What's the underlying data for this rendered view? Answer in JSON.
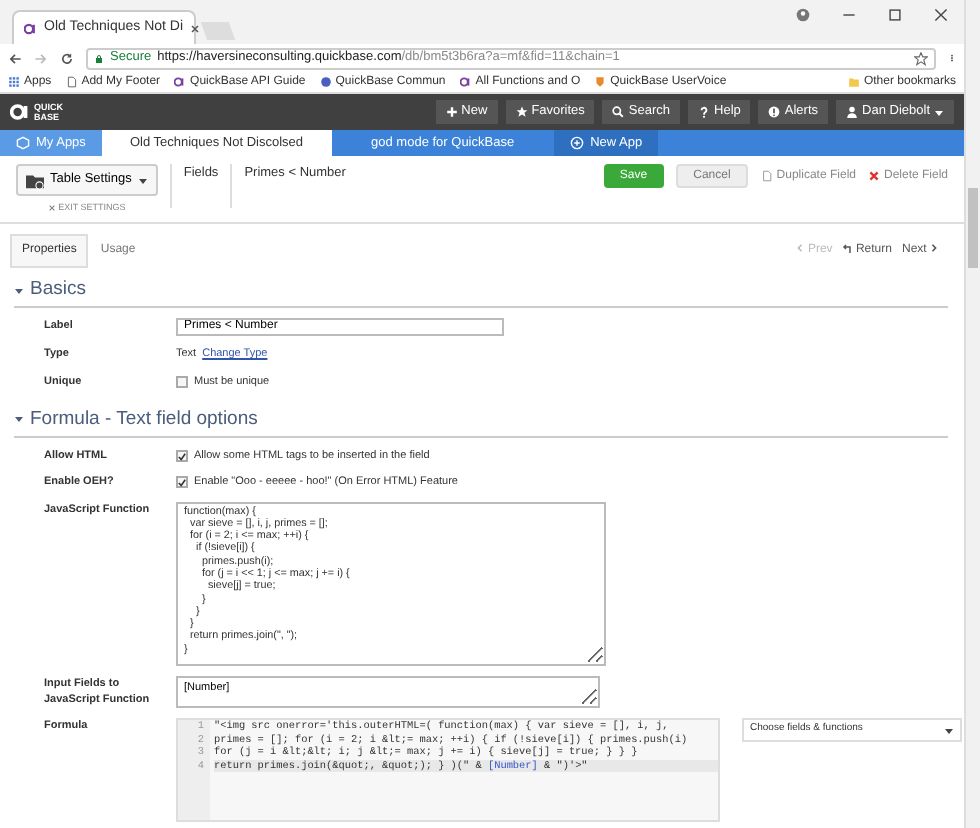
{
  "browser": {
    "tabs": [
      {
        "title": "Old Techniques Not Di",
        "selected": true
      }
    ],
    "secure_label": "Secure",
    "url_host": "https://haversineconsulting.quickbase.com",
    "url_path": "/db/bm5t3b6ra?a=mf&fid=11&chain=1",
    "bookmarks": [
      {
        "label": "Apps",
        "kind": "apps"
      },
      {
        "label": "Add My Footer",
        "kind": "page"
      },
      {
        "label": "QuickBase API Guide",
        "kind": "qb"
      },
      {
        "label": "QuickBase Commun",
        "kind": "globe"
      },
      {
        "label": "All Functions and O",
        "kind": "qb"
      },
      {
        "label": "QuickBase UserVoice",
        "kind": "uv"
      }
    ],
    "other_bookmarks": "Other bookmarks"
  },
  "app_bar": {
    "logo_top": "QUICK",
    "logo_bottom": "BASE",
    "buttons": [
      {
        "label": "New",
        "kind": "plus"
      },
      {
        "label": "Favorites",
        "kind": "star"
      },
      {
        "label": "Search",
        "kind": "search"
      },
      {
        "label": "Help",
        "kind": "help"
      },
      {
        "label": "Alerts",
        "kind": "alert"
      }
    ],
    "user": "Dan Diebolt"
  },
  "app_tabs": [
    {
      "label": "My Apps",
      "kind": "home",
      "selected": false
    },
    {
      "label": "Old Techniques Not Discolsed",
      "kind": "app",
      "selected": true
    },
    {
      "label": "god mode for QuickBase",
      "kind": "app",
      "selected": false
    },
    {
      "label": "New App",
      "kind": "new",
      "selected": false
    }
  ],
  "header": {
    "table_settings": "Table Settings",
    "exit_settings": "EXIT SETTINGS",
    "breadcrumbs": [
      "Fields",
      "Primes < Number"
    ],
    "save": "Save",
    "cancel": "Cancel",
    "duplicate": "Duplicate Field",
    "delete": "Delete Field"
  },
  "tabs": [
    {
      "label": "Properties",
      "selected": true
    },
    {
      "label": "Usage",
      "selected": false
    }
  ],
  "pager": {
    "prev": "Prev",
    "prev_disabled": true,
    "return": "Return",
    "next": "Next"
  },
  "basics": {
    "title": "Basics",
    "expanded": true,
    "label_label": "Label",
    "label_value": "Primes < Number",
    "type_label": "Type",
    "type_value": "Text",
    "change_type": "Change Type",
    "unique_label": "Unique",
    "unique_text": "Must be unique",
    "unique_checked": false
  },
  "formula_section": {
    "title": "Formula - Text field options",
    "expanded": true,
    "allow_html_label": "Allow HTML",
    "allow_html_text": "Allow some HTML tags to be inserted in the field",
    "allow_html_checked": true,
    "oeh_label": "Enable OEH?",
    "oeh_text": "Enable \"Ooo - eeeee - hoo!\" (On Error HTML) Feature",
    "oeh_checked": true,
    "js_label": "JavaScript Function",
    "js_value": "function(max) {\n  var sieve = [], i, j, primes = [];\n  for (i = 2; i <= max; ++i) {\n    if (!sieve[i]) {\n      primes.push(i);\n      for (j = i << 1; j <= max; j += i) {\n        sieve[j] = true;\n      }\n    }\n  }\n  return primes.join(\", \");\n}",
    "inputs_label": "Input Fields to JavaScript Function",
    "inputs_value": "[Number]",
    "formula_label": "Formula",
    "formula_lines": [
      {
        "number": "1",
        "parts": [
          {
            "text": "\"<img src onerror='this.outerHTML=( function(max) { var sieve = [], i, j,",
            "kind": "string"
          }
        ]
      },
      {
        "number": "2",
        "parts": [
          {
            "text": "primes = []; for (i = 2; i &lt;= max; ++i) { if (!sieve[i]) { primes.push(i)",
            "kind": "string"
          }
        ]
      },
      {
        "number": "3",
        "parts": [
          {
            "text": "for (j = i &lt;&lt; i; j &lt;= max; j += i) { sieve[j] = true; } } }",
            "kind": "string"
          }
        ]
      },
      {
        "number": "4",
        "active": true,
        "parts": [
          {
            "text": "return primes.join(&quot;, &quot;); } )(\" & ",
            "kind": "string"
          },
          {
            "text": "[Number]",
            "kind": "field"
          },
          {
            "text": " & \")'>\"",
            "kind": "string"
          }
        ]
      }
    ],
    "choose": "Choose fields & functions"
  }
}
